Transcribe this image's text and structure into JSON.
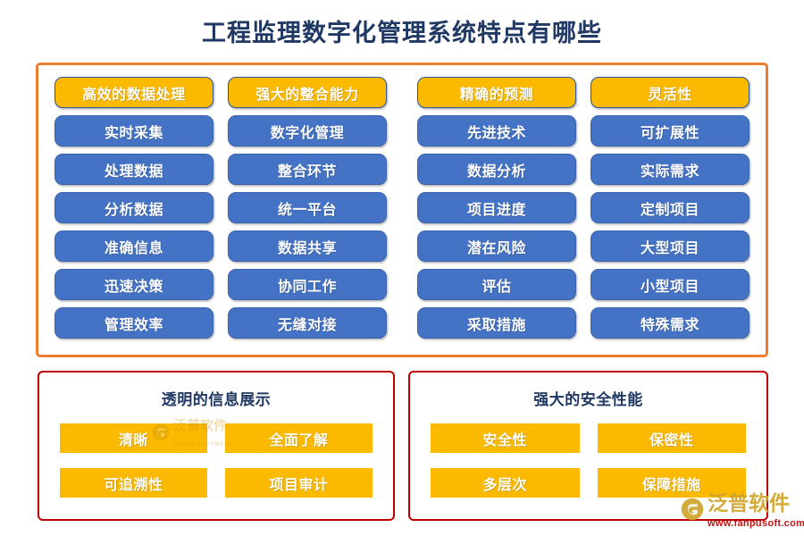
{
  "title": "工程监理数字化管理系统特点有哪些",
  "colors": {
    "title_text": "#1F3864",
    "outer_frame": "#ED7D31",
    "panel_frame": "#C00000",
    "accent": "#FBBA00",
    "primary": "#4472C4",
    "tile_text": "#FFFFFF"
  },
  "feature_grid": {
    "columns": [
      {
        "header": "高效的数据处理",
        "items": [
          "实时采集",
          "处理数据",
          "分析数据",
          "准确信息",
          "迅速决策",
          "管理效率"
        ]
      },
      {
        "header": "强大的整合能力",
        "items": [
          "数字化管理",
          "整合环节",
          "统一平台",
          "数据共享",
          "协同工作",
          "无缝对接"
        ]
      },
      {
        "header": "精确的预测",
        "items": [
          "先进技术",
          "数据分析",
          "项目进度",
          "潜在风险",
          "评估",
          "采取措施"
        ]
      },
      {
        "header": "灵活性",
        "items": [
          "可扩展性",
          "实际需求",
          "定制项目",
          "大型项目",
          "小型项目",
          "特殊需求"
        ]
      }
    ]
  },
  "bottom_panels": [
    {
      "heading": "透明的信息展示",
      "tiles": [
        "清晰",
        "全面了解",
        "可追溯性",
        "项目审计"
      ]
    },
    {
      "heading": "强大的安全性能",
      "tiles": [
        "安全性",
        "保密性",
        "多层次",
        "保障措施"
      ]
    }
  ],
  "watermark": {
    "brand_zh": "泛普软件",
    "brand_en": "FANPU SOFTWARE"
  },
  "brand_logo": {
    "name_zh": "泛普软件",
    "url": "www.fanpusoft.com"
  }
}
